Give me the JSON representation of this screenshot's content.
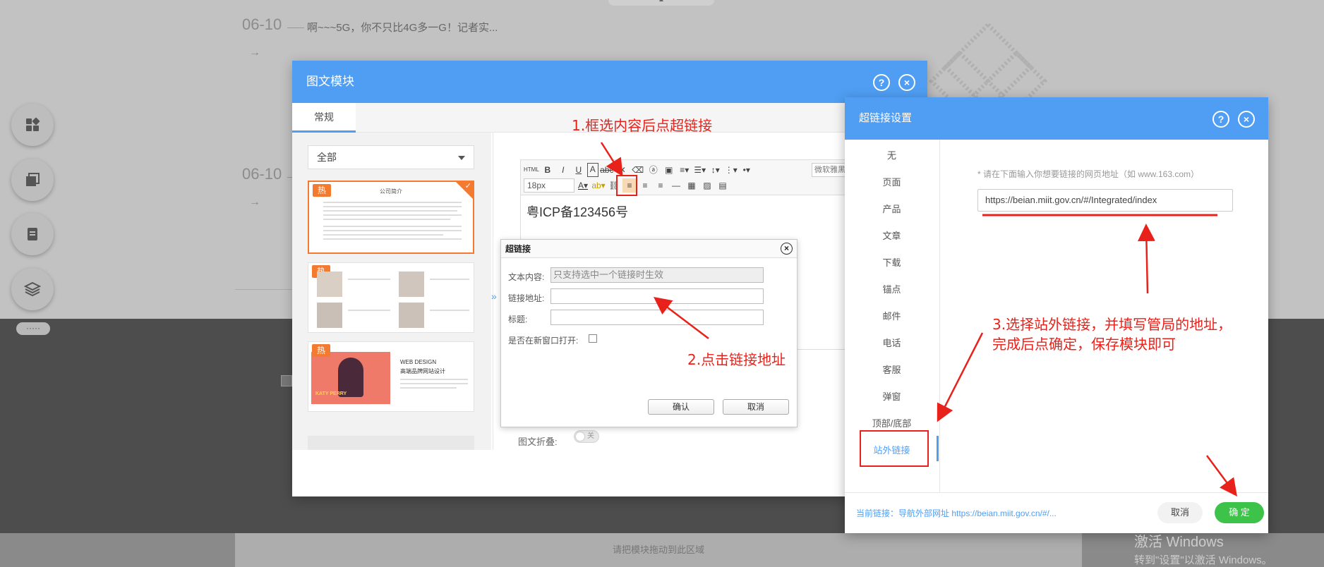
{
  "background": {
    "news": [
      {
        "date": "06-10",
        "title": "啊~~~5G，你不只比4G多一G！记者实..."
      },
      {
        "date": "06-10",
        "title": ""
      }
    ],
    "arrow": "→",
    "drop_hint": "请把模块拖动到此区域",
    "side_dots": "·····"
  },
  "modal": {
    "title": "图文模块",
    "help": "?",
    "close": "×",
    "tab_general": "常规",
    "category": "全部",
    "hot_label": "热",
    "tpl1_title": "公司简介",
    "tpl3_heading": "WEB DESIGN",
    "tpl3_sub": "高端品牌网站设计",
    "tpl3_name": "KATY PERRY",
    "collapse_arrow": "»",
    "font_size": "18px",
    "font_family": "微软雅黑",
    "editor_text": "粤ICP备123456号",
    "fold_label": "图文折叠:",
    "fold_toggle": "关"
  },
  "link_dialog": {
    "title": "超链接",
    "text_label": "文本内容:",
    "text_placeholder": "只支持选中一个链接时生效",
    "url_label": "链接地址:",
    "title_label": "标题:",
    "new_window_label": "是否在新窗口打开:",
    "confirm": "确认",
    "cancel": "取消"
  },
  "hyperlink_panel": {
    "title": "超链接设置",
    "nav": [
      "无",
      "页面",
      "产品",
      "文章",
      "下载",
      "锚点",
      "邮件",
      "电话",
      "客服",
      "弹窗",
      "顶部/底部",
      "站外链接"
    ],
    "active_index": 11,
    "hint": "* 请在下面输入你想要链接的网页地址（如 www.163.com）",
    "url_value": "https://beian.miit.gov.cn/#/Integrated/index",
    "current_link": "当前链接：导航外部网址 https://beian.miit.gov.cn/#/...",
    "cancel": "取消",
    "ok": "确 定"
  },
  "annotations": {
    "step1": "1.框选内容后点超链接",
    "step2": "2.点击链接地址",
    "step3_line1": "3.选择站外链接，并填写管局的地址，",
    "step3_line2": "完成后点确定，保存模块即可"
  },
  "watermark": {
    "line1": "激活 Windows",
    "line2": "转到\"设置\"以激活 Windows。"
  },
  "colors": {
    "primary": "#4f9ef3",
    "hot": "#f47a2f",
    "annotation": "#e8221b",
    "ok_button": "#3dc24a"
  }
}
